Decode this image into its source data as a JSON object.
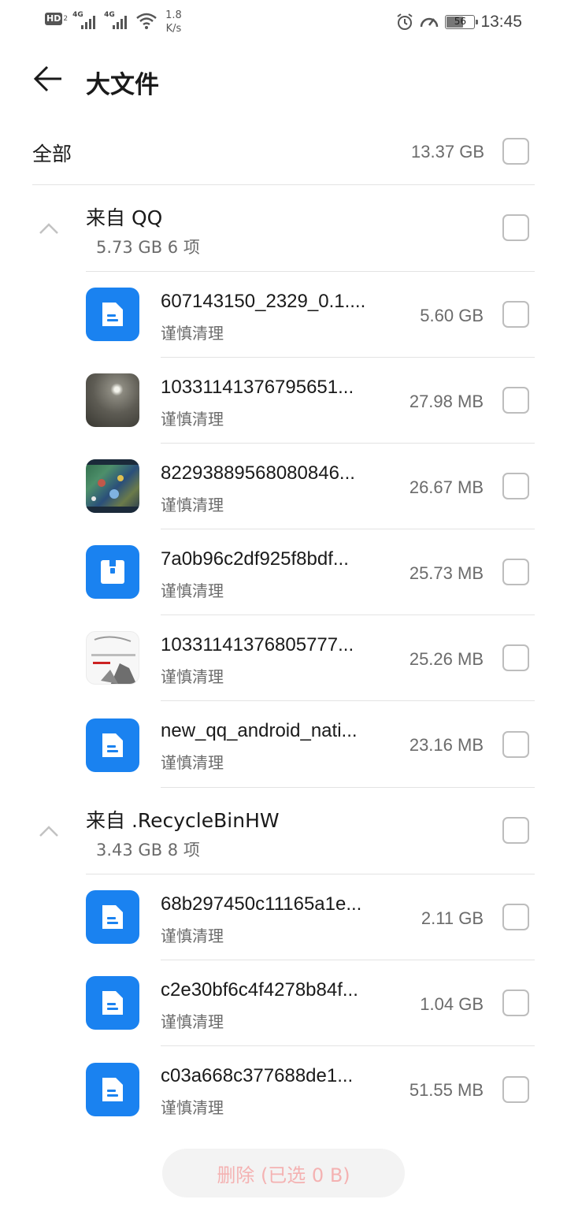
{
  "status_bar": {
    "hd_label": "HD",
    "hd_sub": "2",
    "signal1_label": "4G",
    "signal2_label": "4G",
    "net_speed_value": "1.8",
    "net_speed_unit": "K/s",
    "battery_level": "56",
    "time": "13:45",
    "icons": [
      "alarm-icon",
      "speed-icon",
      "battery-icon",
      "wifi-icon",
      "signal-icon"
    ]
  },
  "header": {
    "title": "大文件",
    "back_icon": "arrow-left-icon"
  },
  "all_row": {
    "label": "全部",
    "size": "13.37 GB",
    "checked": false
  },
  "groups": [
    {
      "title": "来自 QQ",
      "subtitle": "5.73 GB 6 项",
      "expanded": true,
      "files": [
        {
          "name": "607143150_2329_0.1....",
          "note": "谨慎清理",
          "size": "5.60 GB",
          "icon": "document-icon"
        },
        {
          "name": "10331141376795651...",
          "note": "谨慎清理",
          "size": "27.98 MB",
          "icon": "photo-thumbnail-dark"
        },
        {
          "name": "82293889568080846...",
          "note": "谨慎清理",
          "size": "26.67 MB",
          "icon": "photo-thumbnail-game"
        },
        {
          "name": "7a0b96c2df925f8bdf...",
          "note": "谨慎清理",
          "size": "25.73 MB",
          "icon": "archive-icon"
        },
        {
          "name": "10331141376805777...",
          "note": "谨慎清理",
          "size": "25.26 MB",
          "icon": "photo-thumbnail-light"
        },
        {
          "name": "new_qq_android_nati...",
          "note": "谨慎清理",
          "size": "23.16 MB",
          "icon": "document-icon"
        }
      ]
    },
    {
      "title": "来自 .RecycleBinHW",
      "subtitle": "3.43 GB 8 项",
      "expanded": true,
      "files": [
        {
          "name": "68b297450c11165a1e...",
          "note": "谨慎清理",
          "size": "2.11 GB",
          "icon": "document-icon"
        },
        {
          "name": "c2e30bf6c4f4278b84f...",
          "note": "谨慎清理",
          "size": "1.04 GB",
          "icon": "document-icon"
        },
        {
          "name": "c03a668c377688de1...",
          "note": "谨慎清理",
          "size": "51.55 MB",
          "icon": "document-icon"
        }
      ]
    }
  ],
  "delete_button": {
    "label": "删除 (已选 0 B)"
  },
  "colors": {
    "accent_blue": "#1a82f0",
    "delete_text_disabled": "#f4b2b2",
    "secondary_text": "#6b6b6b"
  }
}
